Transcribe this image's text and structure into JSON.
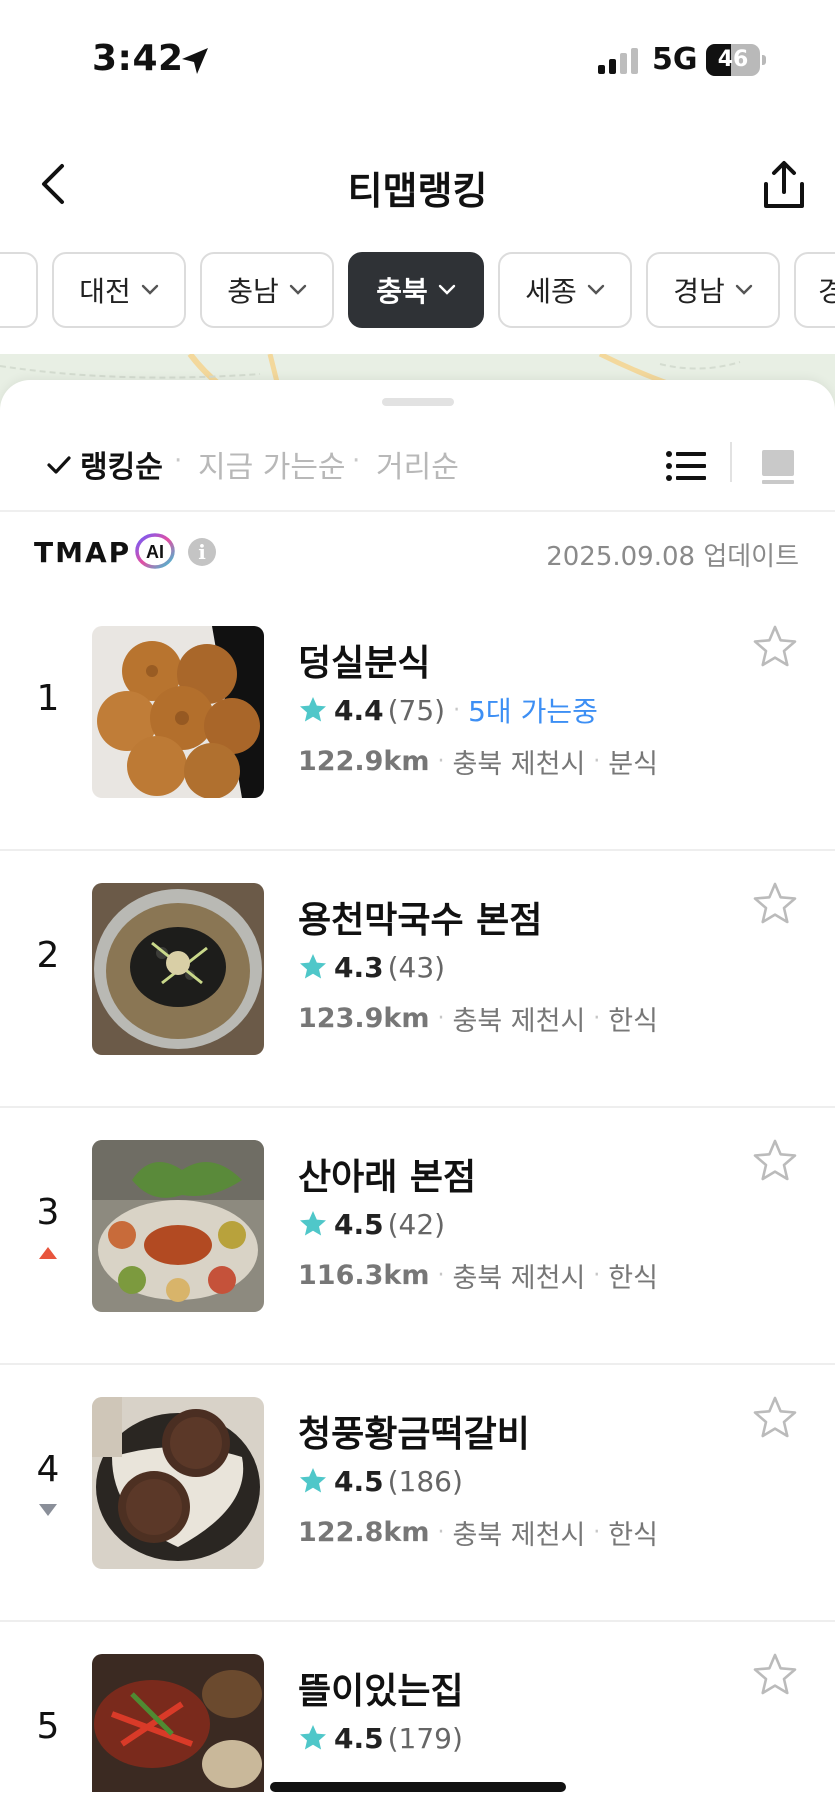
{
  "status_bar": {
    "time": "3:42",
    "network": "5G",
    "battery": "46",
    "battery_level": 0.46
  },
  "header": {
    "title": "티맵랭킹",
    "back_icon": "chevron-left-icon",
    "share_icon": "share-icon"
  },
  "regions": [
    {
      "label": ""
    },
    {
      "label": "대전"
    },
    {
      "label": "충남"
    },
    {
      "label": "충북",
      "selected": true
    },
    {
      "label": "세종"
    },
    {
      "label": "경남"
    },
    {
      "label": "경"
    }
  ],
  "sort": {
    "options": [
      "랭킹순",
      "지금 가는순",
      "거리순"
    ],
    "active": "랭킹순"
  },
  "ai_bar": {
    "logo": "TMAP",
    "badge": "AI",
    "update": "2025.09.08 업데이트"
  },
  "restaurants": [
    {
      "rank": "1",
      "name": "덩실분식",
      "rating": "4.4",
      "count": "(75)",
      "live": "5대 가는중",
      "distance": "122.9km",
      "region": "충북 제천시",
      "category": "분식",
      "trend": "none"
    },
    {
      "rank": "2",
      "name": "용천막국수 본점",
      "rating": "4.3",
      "count": "(43)",
      "live": "",
      "distance": "123.9km",
      "region": "충북 제천시",
      "category": "한식",
      "trend": "none"
    },
    {
      "rank": "3",
      "name": "산아래 본점",
      "rating": "4.5",
      "count": "(42)",
      "live": "",
      "distance": "116.3km",
      "region": "충북 제천시",
      "category": "한식",
      "trend": "up"
    },
    {
      "rank": "4",
      "name": "청풍황금떡갈비",
      "rating": "4.5",
      "count": "(186)",
      "live": "",
      "distance": "122.8km",
      "region": "충북 제천시",
      "category": "한식",
      "trend": "down"
    },
    {
      "rank": "5",
      "name": "뜰이있는집",
      "rating": "4.5",
      "count": "(179)",
      "live": "",
      "distance": "",
      "region": "",
      "category": "",
      "trend": "none"
    }
  ],
  "colors": {
    "accent_blue": "#3d8ff4",
    "star_teal": "#4fc7c9",
    "trend_up": "#e8553d",
    "trend_down": "#8a8f99",
    "selected_chip": "#2f3236"
  }
}
